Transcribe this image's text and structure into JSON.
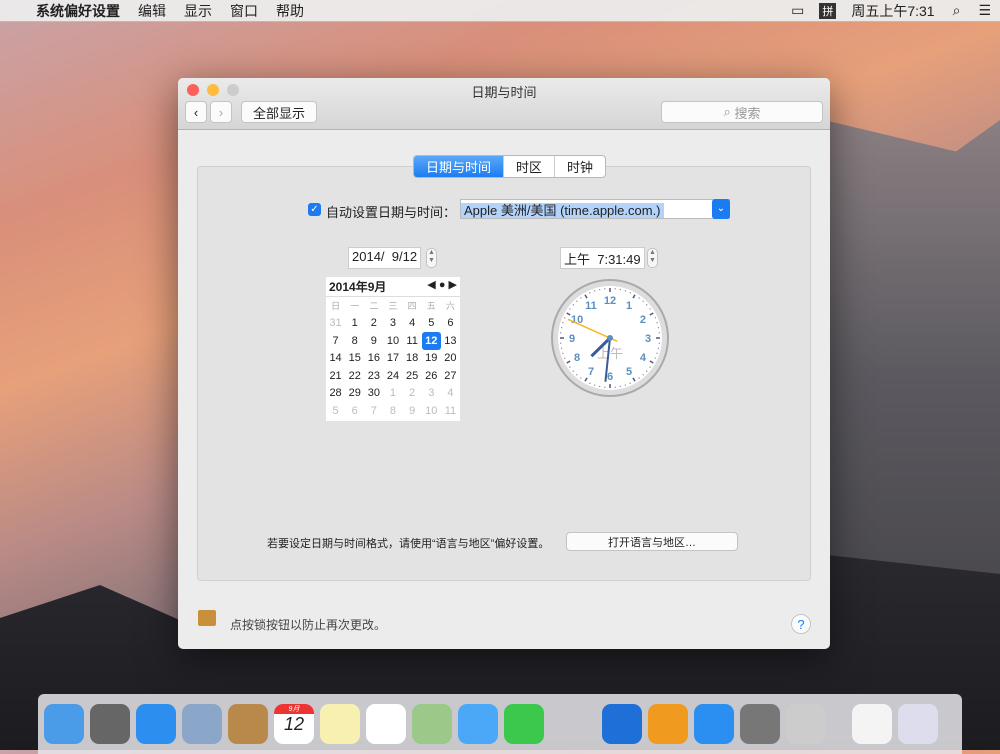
{
  "menubar": {
    "app": "系统偏好设置",
    "items": [
      "编辑",
      "显示",
      "窗口",
      "帮助"
    ],
    "clock": "周五上午7:31",
    "input_method": "拼"
  },
  "window": {
    "title": "日期与时间",
    "show_all": "全部显示",
    "search_placeholder": "搜索",
    "tabs": [
      "日期与时间",
      "时区",
      "时钟"
    ],
    "auto_label": "自动设置日期与时间：",
    "auto_checked": true,
    "server": "Apple 美洲/美国 (time.apple.com.)",
    "date_value": "2014/  9/12",
    "time_value": "上午  7:31:49",
    "calendar": {
      "title": "2014年9月",
      "weekdays": [
        "日",
        "一",
        "二",
        "三",
        "四",
        "五",
        "六"
      ],
      "weeks": [
        [
          "31",
          "1",
          "2",
          "3",
          "4",
          "5",
          "6"
        ],
        [
          "7",
          "8",
          "9",
          "10",
          "11",
          "12",
          "13"
        ],
        [
          "14",
          "15",
          "16",
          "17",
          "18",
          "19",
          "20"
        ],
        [
          "21",
          "22",
          "23",
          "24",
          "25",
          "26",
          "27"
        ],
        [
          "28",
          "29",
          "30",
          "1",
          "2",
          "3",
          "4"
        ],
        [
          "5",
          "6",
          "7",
          "8",
          "9",
          "10",
          "11"
        ]
      ],
      "selected": "12"
    },
    "clock": {
      "hour": 7,
      "minute": 31,
      "second": 49,
      "ampm": "上午",
      "numbers": [
        "12",
        "1",
        "2",
        "3",
        "4",
        "5",
        "6",
        "7",
        "8",
        "9",
        "10",
        "11"
      ]
    },
    "format_hint": "若要设定日期与时间格式，请使用“语言与地区”偏好设置。",
    "open_region": "打开语言与地区…",
    "lock_text": "点按锁按钮以防止再次更改。",
    "help": "?"
  },
  "dock": [
    "finder",
    "launchpad",
    "safari",
    "mail",
    "contacts",
    "calendar",
    "notes",
    "reminders",
    "maps",
    "messages",
    "facetime",
    "itunes",
    "ibooks",
    "app-store",
    "system-preferences",
    "utility",
    "preview-doc",
    "trash"
  ],
  "dock_calendar": {
    "month": "9月",
    "day": "12"
  },
  "colors": {
    "accent": "#1b7cf2"
  }
}
